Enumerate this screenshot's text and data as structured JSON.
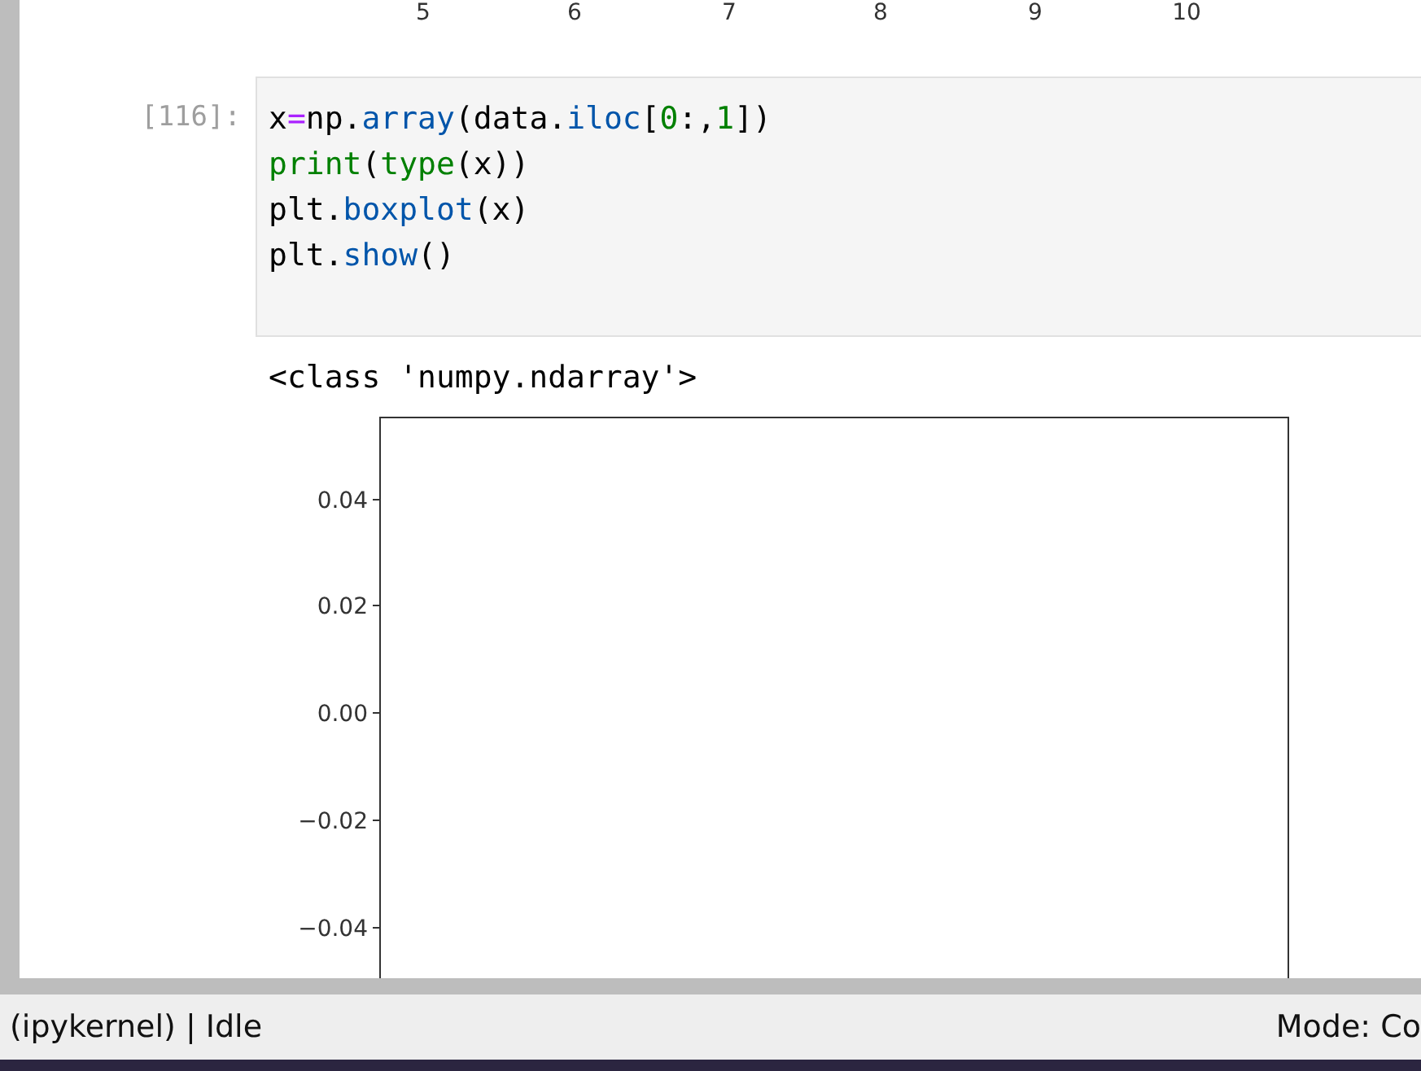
{
  "previous_plot": {
    "xtick_labels": [
      "5",
      "6",
      "7",
      "8",
      "9",
      "10"
    ]
  },
  "cell": {
    "prompt": "[116]:",
    "code_lines": [
      [
        {
          "text": "x",
          "kind": "plain"
        },
        {
          "text": "=",
          "kind": "operator"
        },
        {
          "text": "np.",
          "kind": "plain"
        },
        {
          "text": "array",
          "kind": "function"
        },
        {
          "text": "(data.",
          "kind": "plain"
        },
        {
          "text": "iloc",
          "kind": "function"
        },
        {
          "text": "[",
          "kind": "plain"
        },
        {
          "text": "0",
          "kind": "number"
        },
        {
          "text": ":,",
          "kind": "plain"
        },
        {
          "text": "1",
          "kind": "number"
        },
        {
          "text": "])",
          "kind": "plain"
        }
      ],
      [
        {
          "text": "print",
          "kind": "builtin"
        },
        {
          "text": "(",
          "kind": "plain"
        },
        {
          "text": "type",
          "kind": "builtin"
        },
        {
          "text": "(x))",
          "kind": "plain"
        }
      ],
      [
        {
          "text": "plt.",
          "kind": "plain"
        },
        {
          "text": "boxplot",
          "kind": "function"
        },
        {
          "text": "(x)",
          "kind": "plain"
        }
      ],
      [
        {
          "text": "plt.",
          "kind": "plain"
        },
        {
          "text": "show",
          "kind": "function"
        },
        {
          "text": "()",
          "kind": "plain"
        }
      ]
    ],
    "output_text": "<class 'numpy.ndarray'>",
    "plot": {
      "ytick_labels": [
        "0.04",
        "0.02",
        "0.00",
        "−0.02",
        "−0.04"
      ]
    }
  },
  "status_bar": {
    "kernel": "(ipykernel) | Idle",
    "mode": "Mode: Co"
  }
}
